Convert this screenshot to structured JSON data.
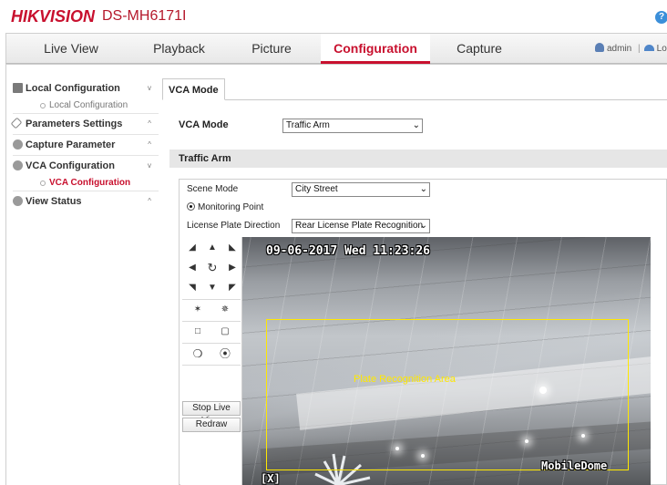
{
  "header": {
    "brand": "HIKVISION",
    "model": "DS-MH6171I",
    "help_icon": "?"
  },
  "nav": {
    "tabs": [
      {
        "label": "Live View",
        "active": false
      },
      {
        "label": "Playback",
        "active": false
      },
      {
        "label": "Picture",
        "active": false
      },
      {
        "label": "Configuration",
        "active": true
      },
      {
        "label": "Capture",
        "active": false
      }
    ],
    "user": "admin",
    "separator": "|",
    "logout": "Logout"
  },
  "sidebar": {
    "items": [
      {
        "label": "Local Configuration",
        "icon": "monitor-icon",
        "chevron": "v",
        "sub": [
          "Local Configuration"
        ]
      },
      {
        "label": "Parameters Settings",
        "icon": "wrench-icon",
        "chevron": "^"
      },
      {
        "label": "Capture Parameter",
        "icon": "gear-icon",
        "chevron": "^"
      },
      {
        "label": "VCA Configuration",
        "icon": "gear-icon",
        "chevron": "v",
        "sub": [
          "VCA Configuration"
        ]
      },
      {
        "label": "View Status",
        "icon": "gear-icon",
        "chevron": "^"
      }
    ]
  },
  "content": {
    "subtab": "VCA Mode",
    "vca_mode_label": "VCA Mode",
    "vca_mode_value": "Traffic Arm",
    "section_title": "Traffic Arm",
    "scene_mode_label": "Scene Mode",
    "scene_mode_value": "City Street",
    "monitoring_point": "Monitoring Point",
    "lpd_label": "License Plate Direction",
    "lpd_value": "Rear License Plate Recognition"
  },
  "ptz": {
    "stop_live_view": "Stop Live View",
    "redraw": "Redraw"
  },
  "video": {
    "timestamp": "09-06-2017 Wed 11:23:26",
    "roi_label": "Plate Recognition Area",
    "channel_name": "MobileDome",
    "corner_mark": "[X]"
  },
  "colors": {
    "brand_red": "#c8102e",
    "roi_yellow": "#ffe800",
    "link_blue": "#3b8fd9"
  }
}
